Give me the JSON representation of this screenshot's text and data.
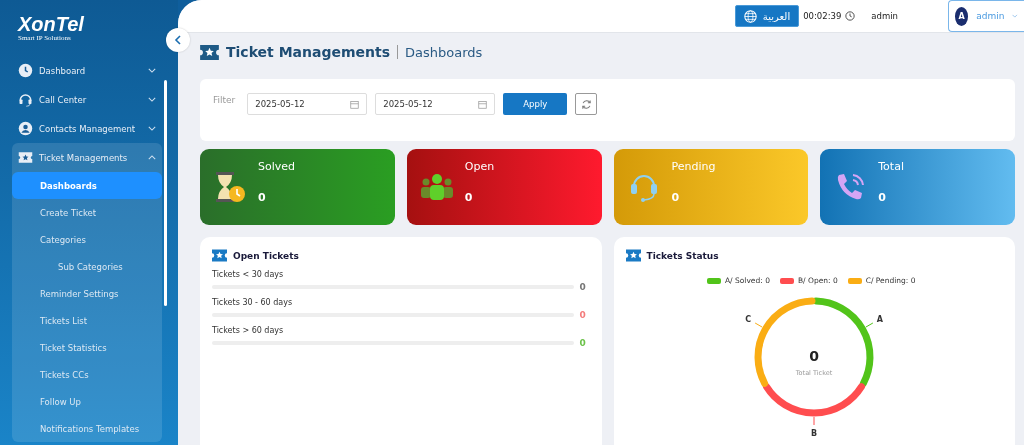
{
  "logo": {
    "name": "XonTel",
    "tagline": "Smart IP Solutions"
  },
  "sidebar": {
    "items": [
      {
        "label": "Dashboard",
        "expanded": false
      },
      {
        "label": "Call Center",
        "expanded": false
      },
      {
        "label": "Contacts Management",
        "expanded": false
      },
      {
        "label": "Ticket Managements",
        "expanded": true,
        "children": [
          {
            "label": "Dashboards",
            "selected": true
          },
          {
            "label": "Create Ticket",
            "selected": false
          },
          {
            "label": "Categories",
            "selected": false,
            "children": [
              {
                "label": "Sub Categories",
                "selected": false
              }
            ]
          },
          {
            "label": "Reminder Settings",
            "selected": false
          },
          {
            "label": "Tickets List",
            "selected": false
          },
          {
            "label": "Ticket Statistics",
            "selected": false
          },
          {
            "label": "Tickets CCs",
            "selected": false
          },
          {
            "label": "Follow Up",
            "selected": false
          },
          {
            "label": "Notifications Templates",
            "selected": false
          }
        ]
      }
    ]
  },
  "header": {
    "language_button": "العربية",
    "timer": "00:02:39",
    "username": "admin",
    "user_menu": {
      "avatar": "A",
      "name": "admin"
    }
  },
  "page_title": {
    "section": "Ticket Managements",
    "page": "Dashboards"
  },
  "filter": {
    "label": "Filter",
    "from_date": "2025-05-12",
    "to_date": "2025-05-12",
    "apply_button": "Apply"
  },
  "stat_cards": [
    {
      "kind": "solved",
      "title": "Solved",
      "value": "0"
    },
    {
      "kind": "open",
      "title": "Open",
      "value": "0"
    },
    {
      "kind": "pending",
      "title": "Pending",
      "value": "0"
    },
    {
      "kind": "total",
      "title": "Total",
      "value": "0"
    }
  ],
  "open_tickets": {
    "title": "Open Tickets",
    "rows": [
      {
        "label": "Tickets < 30 days",
        "level": 0,
        "value": "0",
        "color": "#777777"
      },
      {
        "label": "Tickets 30 - 60 days",
        "level": 0,
        "value": "0",
        "color": "#f47c7c"
      },
      {
        "label": "Tickets > 60 days",
        "level": 0,
        "value": "0",
        "color": "#6cc24a"
      }
    ]
  },
  "tickets_status": {
    "title": "Tickets Status",
    "legend": [
      {
        "label": "A/ Solved: 0",
        "color": "#52c41a"
      },
      {
        "label": "B/ Open: 0",
        "color": "#ff4d4f"
      },
      {
        "label": "C/ Pending: 0",
        "color": "#faad14"
      }
    ],
    "segment_labels": [
      "C",
      "A",
      "B"
    ],
    "center_value": "0",
    "center_label": "Total Ticket"
  }
}
